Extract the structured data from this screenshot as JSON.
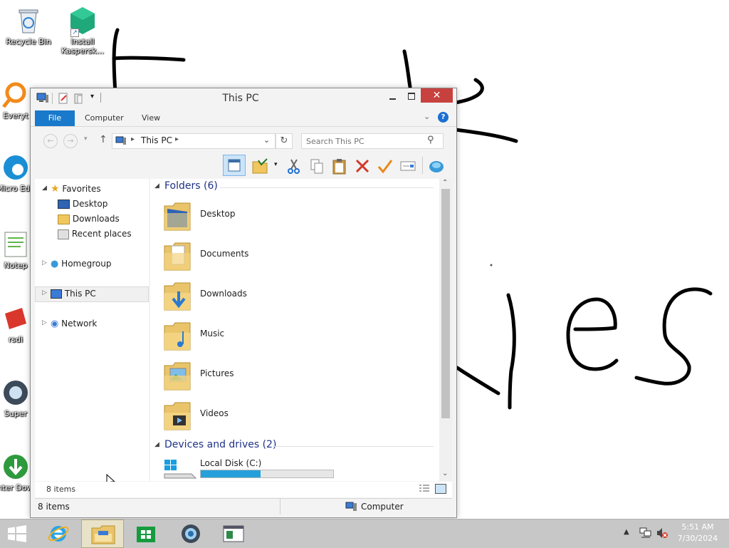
{
  "desktop": {
    "icons": [
      {
        "label": "Recycle Bin"
      },
      {
        "label": "Install Kaspersk..."
      },
      {
        "label": "Everyt"
      },
      {
        "label": "Micro Edg"
      },
      {
        "label": "Notep"
      },
      {
        "label": "rsdi"
      },
      {
        "label": "Super"
      },
      {
        "label": "Inter Dowr"
      }
    ]
  },
  "window": {
    "title": "This PC",
    "ribbon_tabs": {
      "file": "File",
      "computer": "Computer",
      "view": "View"
    },
    "address": {
      "location": "This PC",
      "search_placeholder": "Search This PC"
    },
    "nav": {
      "favorites": "Favorites",
      "desktop": "Desktop",
      "downloads": "Downloads",
      "recent": "Recent places",
      "homegroup": "Homegroup",
      "this_pc": "This PC",
      "network": "Network"
    },
    "content": {
      "folders_header": "Folders (6)",
      "folders": [
        "Desktop",
        "Documents",
        "Downloads",
        "Music",
        "Pictures",
        "Videos"
      ],
      "drives_header": "Devices and drives (2)",
      "drive_name": "Local Disk (C:)",
      "drive_used_fraction": 0.45
    },
    "status_inner": "8 items",
    "status_outer_left": "8 items",
    "status_outer_right": "Computer"
  },
  "taskbar": {
    "time": "5:51 AM",
    "date": "7/30/2024"
  },
  "colors": {
    "file_tab": "#1979ca",
    "selection": "#e5f3fb",
    "drive_bar": "#26a0da",
    "close_button": "#c7413f"
  }
}
